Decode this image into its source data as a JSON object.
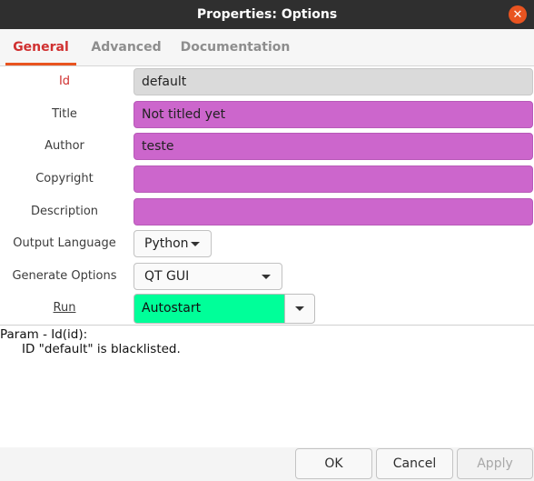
{
  "window": {
    "title": "Properties: Options"
  },
  "tabs": [
    {
      "label": "General",
      "active": true
    },
    {
      "label": "Advanced",
      "active": false
    },
    {
      "label": "Documentation",
      "active": false
    }
  ],
  "fields": {
    "id": {
      "label": "Id",
      "value": "default"
    },
    "title": {
      "label": "Title",
      "value": "Not titled yet"
    },
    "author": {
      "label": "Author",
      "value": "teste"
    },
    "copyright": {
      "label": "Copyright",
      "value": ""
    },
    "description": {
      "label": "Description",
      "value": ""
    },
    "output_language": {
      "label": "Output Language",
      "value": "Python"
    },
    "generate_options": {
      "label": "Generate Options",
      "value": "QT GUI"
    },
    "run": {
      "label": "Run",
      "value": "Autostart"
    }
  },
  "message": {
    "line1": "Param - Id(id):",
    "line2": "ID \"default\" is blacklisted."
  },
  "buttons": {
    "ok": "OK",
    "cancel": "Cancel",
    "apply": "Apply"
  },
  "colors": {
    "titlebar": "#2f2f2f",
    "accent": "#e95420",
    "error_label": "#d03030",
    "invalid_field": "#cc66cc",
    "run_field": "#00ff99",
    "readonly_field": "#dadada"
  }
}
